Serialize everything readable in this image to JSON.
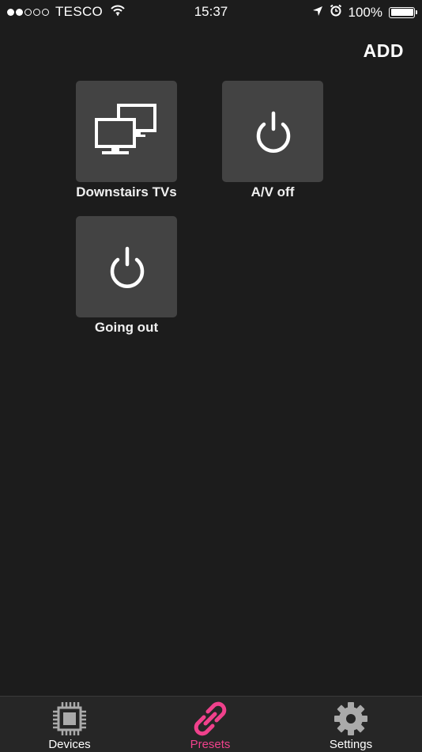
{
  "status_bar": {
    "carrier": "TESCO",
    "time": "15:37",
    "battery_percent": "100%",
    "battery_level": 1.0,
    "signal_bars_filled": 2,
    "signal_bars_total": 5,
    "icons": [
      "wifi-icon",
      "location-arrow-icon",
      "alarm-clock-icon",
      "battery-icon"
    ]
  },
  "header": {
    "add_label": "ADD"
  },
  "presets": [
    {
      "label": "Downstairs TVs",
      "icon": "monitors-icon"
    },
    {
      "label": "A/V off",
      "icon": "power-icon"
    },
    {
      "label": "Going out",
      "icon": "power-icon"
    }
  ],
  "tab_bar": {
    "active": "Presets",
    "accent_color": "#f0418c",
    "tabs": [
      {
        "label": "Devices",
        "icon": "chip-icon"
      },
      {
        "label": "Presets",
        "icon": "link-icon"
      },
      {
        "label": "Settings",
        "icon": "gear-icon"
      }
    ]
  },
  "colors": {
    "background": "#1c1c1c",
    "tile": "#434343",
    "tab_bar": "#262626"
  }
}
